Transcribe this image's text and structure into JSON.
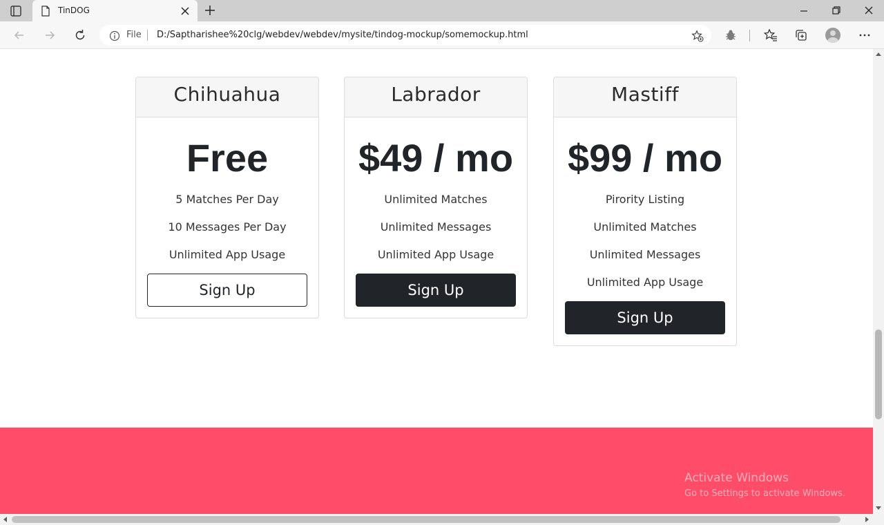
{
  "browser": {
    "tab_title": "TinDOG",
    "address": {
      "scheme_label": "File",
      "url": "D:/Saptharishee%20clg/webdev/webdev/mysite/tindog-mockup/somemockup.html"
    },
    "icons": [
      "tab-actions-icon",
      "page-icon",
      "close-icon",
      "plus-icon",
      "minimize-icon",
      "restore-icon",
      "close-window-icon",
      "back-arrow-icon",
      "forward-arrow-icon",
      "refresh-icon",
      "info-icon",
      "add-favorite-icon",
      "extension-bug-icon",
      "favorites-icon",
      "collections-icon",
      "profile-avatar-icon",
      "more-icon"
    ]
  },
  "pricing": [
    {
      "name": "Chihuahua",
      "price": "Free",
      "features": [
        "5 Matches Per Day",
        "10 Messages Per Day",
        "Unlimited App Usage"
      ],
      "button": "Sign Up",
      "button_style": "outline"
    },
    {
      "name": "Labrador",
      "price": "$49 / mo",
      "features": [
        "Unlimited Matches",
        "Unlimited Messages",
        "Unlimited App Usage"
      ],
      "button": "Sign Up",
      "button_style": "dark"
    },
    {
      "name": "Mastiff",
      "price": "$99 / mo",
      "features": [
        "Pirority Listing",
        "Unlimited Matches",
        "Unlimited Messages",
        "Unlimited App Usage"
      ],
      "button": "Sign Up",
      "button_style": "dark"
    }
  ],
  "watermark": {
    "title": "Activate Windows",
    "subtitle": "Go to Settings to activate Windows."
  },
  "colors": {
    "band": "#ff4c68",
    "button_dark": "#212529",
    "card_header": "#f6f6f6"
  }
}
